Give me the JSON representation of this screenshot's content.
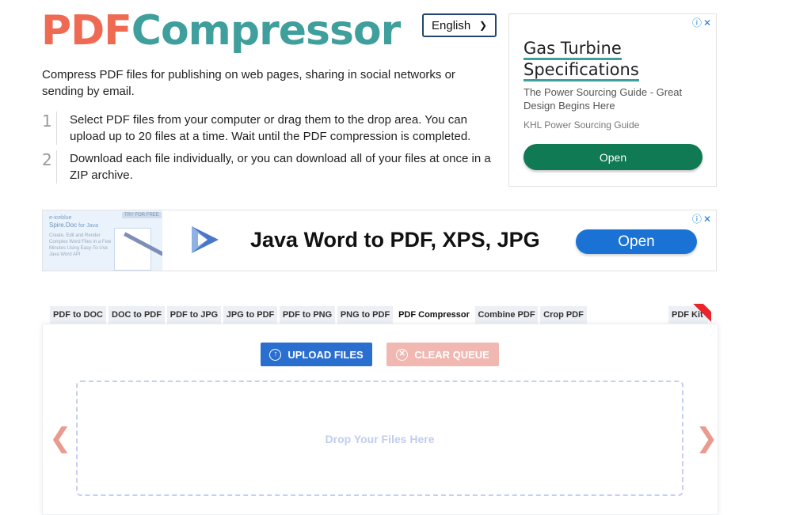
{
  "brand": {
    "part1": "PDF",
    "part2": "Compressor"
  },
  "language": {
    "selected": "English"
  },
  "intro": "Compress PDF files for publishing on web pages, sharing in social networks or sending by email.",
  "steps": [
    {
      "num": "1",
      "text": "Select PDF files from your computer or drag them to the drop area. You can upload up to 20 files at a time. Wait until the PDF compression is completed."
    },
    {
      "num": "2",
      "text": "Download each file individually, or you can download all of your files at once in a ZIP archive."
    }
  ],
  "ad_side": {
    "title": "Gas Turbine Specifications",
    "description": "The Power Sourcing Guide - Great Design Begins Here",
    "source": "KHL Power Sourcing Guide",
    "button": "Open"
  },
  "ad_banner": {
    "thumb_brand": "e-iceblue",
    "thumb_product": "Spire.Doc",
    "thumb_product_suffix": "for Java",
    "thumb_tag": "TRY FOR FREE",
    "thumb_text": "Create, Edit and Render Complex Word Files in a Few Minutes Using Easy-To-Use Java Word API",
    "headline": "Java Word to PDF, XPS, JPG",
    "button": "Open"
  },
  "tabs": [
    {
      "label": "PDF to DOC",
      "active": false
    },
    {
      "label": "DOC to PDF",
      "active": false
    },
    {
      "label": "PDF to JPG",
      "active": false
    },
    {
      "label": "JPG to PDF",
      "active": false
    },
    {
      "label": "PDF to PNG",
      "active": false
    },
    {
      "label": "PNG to PDF",
      "active": false
    },
    {
      "label": "PDF Compressor",
      "active": true
    },
    {
      "label": "Combine PDF",
      "active": false
    },
    {
      "label": "Crop PDF",
      "active": false
    },
    {
      "label": "PDF Kit",
      "active": false
    }
  ],
  "tools": {
    "upload": "UPLOAD FILES",
    "clear": "CLEAR QUEUE",
    "drop_label": "Drop Your Files Here"
  },
  "colors": {
    "brand_pdf": "#ef6a53",
    "brand_comp": "#3f9f9c",
    "upload_button": "#2a6fd0",
    "clear_button": "#f1b8b2",
    "ad_open": "#0f7a53",
    "banner_open": "#1a73d4"
  }
}
